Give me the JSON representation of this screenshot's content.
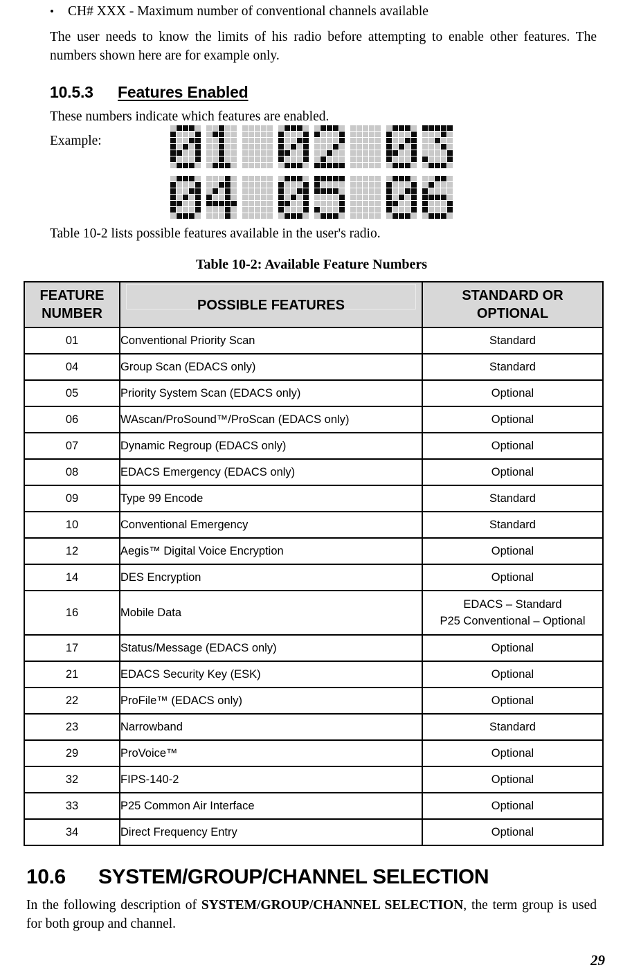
{
  "bullet": {
    "marker": "•",
    "text": "CH# XXX - Maximum number of conventional channels available"
  },
  "intro_paragraph": "The user needs to know the limits of his radio before attempting to enable other features. The numbers shown here are for example only.",
  "heading_10_5_3": {
    "number": "10.5.3",
    "title": "Features Enabled"
  },
  "features_enabled_text": "These numbers indicate which features are enabled.",
  "example_label": "Example:",
  "lcd_display": {
    "rows": [
      [
        "0",
        "1",
        " ",
        "0",
        "2",
        " ",
        "0",
        "3"
      ],
      [
        "0",
        "4",
        " ",
        "0",
        "5",
        " ",
        "0",
        "6"
      ]
    ],
    "on_color": "#0c0c0c",
    "off_color": "#c9c9c9"
  },
  "table_intro": "Table 10-2 lists possible features available in the user's radio.",
  "table": {
    "caption": "Table 10-2:  Available Feature Numbers",
    "headers": [
      "FEATURE NUMBER",
      "POSSIBLE FEATURES",
      "STANDARD OR OPTIONAL"
    ],
    "header_lines": {
      "col1_line1": "FEATURE",
      "col1_line2": "NUMBER",
      "col2": "POSSIBLE FEATURES",
      "col3_line1": "STANDARD OR",
      "col3_line2": "OPTIONAL"
    },
    "header_bg": "#d8d8d8",
    "rows": [
      {
        "number": "01",
        "feature": "Conventional Priority Scan",
        "status": "Standard"
      },
      {
        "number": "04",
        "feature": "Group Scan (EDACS only)",
        "status": "Standard"
      },
      {
        "number": "05",
        "feature": "Priority System Scan (EDACS only)",
        "status": "Optional"
      },
      {
        "number": "06",
        "feature": "WAscan/ProSound™/ProScan (EDACS only)",
        "status": "Optional"
      },
      {
        "number": "07",
        "feature": "Dynamic Regroup (EDACS only)",
        "status": "Optional"
      },
      {
        "number": "08",
        "feature": "EDACS Emergency (EDACS only)",
        "status": "Optional"
      },
      {
        "number": "09",
        "feature": "Type 99 Encode",
        "status": "Standard"
      },
      {
        "number": "10",
        "feature": "Conventional Emergency",
        "status": "Standard"
      },
      {
        "number": "12",
        "feature": "Aegis™ Digital Voice Encryption",
        "status": "Optional"
      },
      {
        "number": "14",
        "feature": "DES Encryption",
        "status": "Optional"
      },
      {
        "number": "16",
        "feature": "Mobile Data",
        "status": "EDACS – Standard",
        "status2": "P25 Conventional – Optional"
      },
      {
        "number": "17",
        "feature": "Status/Message (EDACS only)",
        "status": "Optional"
      },
      {
        "number": "21",
        "feature": "EDACS Security Key (ESK)",
        "status": "Optional"
      },
      {
        "number": "22",
        "feature": "ProFile™ (EDACS only)",
        "status": "Optional"
      },
      {
        "number": "23",
        "feature": "Narrowband",
        "status": "Standard"
      },
      {
        "number": "29",
        "feature": "ProVoice™",
        "status": "Optional"
      },
      {
        "number": "32",
        "feature": "FIPS-140-2",
        "status": "Optional"
      },
      {
        "number": "33",
        "feature": "P25 Common Air Interface",
        "status": "Optional"
      },
      {
        "number": "34",
        "feature": "Direct Frequency Entry",
        "status": "Optional"
      }
    ]
  },
  "heading_10_6": {
    "number": "10.6",
    "title": "SYSTEM/GROUP/CHANNEL SELECTION"
  },
  "closing_paragraph": {
    "before": "In the following description of ",
    "bold": "SYSTEM/GROUP/CHANNEL SELECTION",
    "after": ", the term group is used for both group and channel."
  },
  "page_number": "29"
}
